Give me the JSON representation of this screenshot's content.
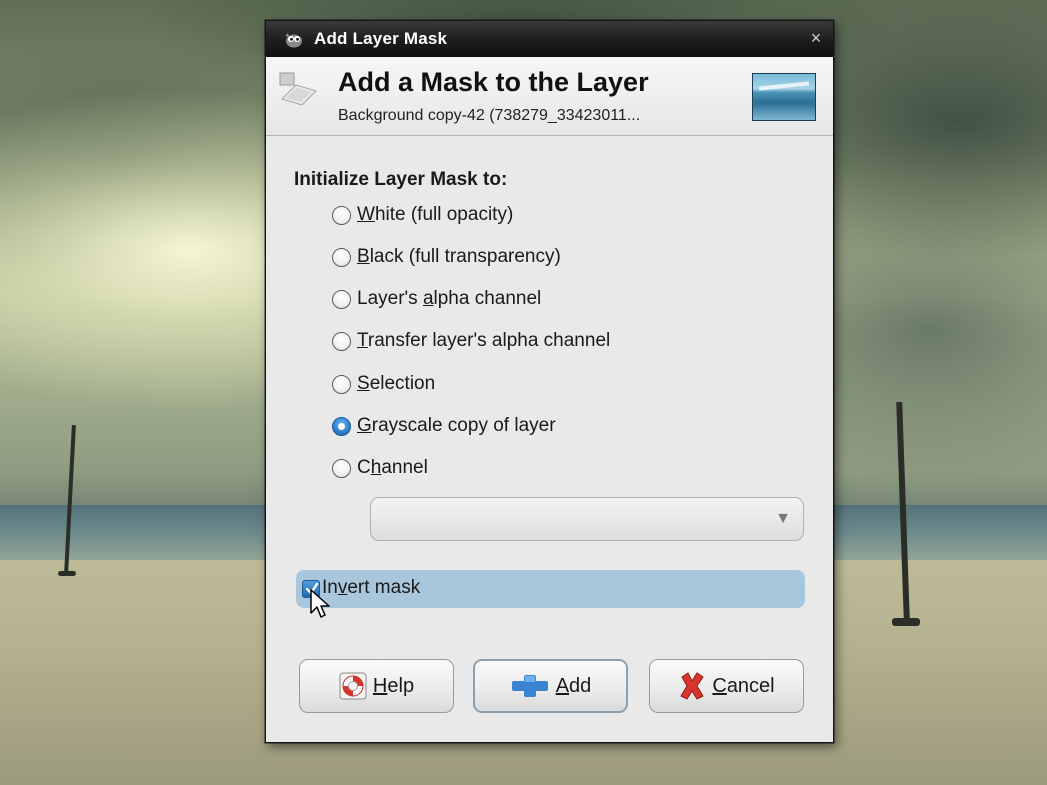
{
  "window": {
    "title": "Add Layer Mask",
    "app_icon": "gimp-wilber-icon",
    "close_glyph": "×"
  },
  "header": {
    "title": "Add a Mask to the Layer",
    "subtitle": "Background copy-42 (738279_33423011...",
    "icon": "layer-mask-icon",
    "thumbnail": "layer-thumbnail"
  },
  "init": {
    "label": "Initialize Layer Mask to:",
    "options": [
      {
        "pre": "",
        "u": "W",
        "post": "hite (full opacity)",
        "checked": false
      },
      {
        "pre": "",
        "u": "B",
        "post": "lack (full transparency)",
        "checked": false
      },
      {
        "pre": "Layer's ",
        "u": "a",
        "post": "lpha channel",
        "checked": false
      },
      {
        "pre": "",
        "u": "T",
        "post": "ransfer layer's alpha channel",
        "checked": false
      },
      {
        "pre": "",
        "u": "S",
        "post": "election",
        "checked": false
      },
      {
        "pre": "",
        "u": "G",
        "post": "rayscale copy of layer",
        "checked": true
      },
      {
        "pre": "C",
        "u": "h",
        "post": "annel",
        "checked": false
      }
    ],
    "selected": "Grayscale copy of layer"
  },
  "channel_select": {
    "value": "",
    "arrow": "▼"
  },
  "invert": {
    "pre": "In",
    "u": "v",
    "post": "ert mask",
    "checked": true
  },
  "buttons": {
    "help": {
      "pre": "",
      "u": "H",
      "post": "elp",
      "icon": "lifebuoy-icon"
    },
    "add": {
      "pre": "",
      "u": "A",
      "post": "dd",
      "icon": "plus-icon"
    },
    "cancel": {
      "pre": "",
      "u": "C",
      "post": "ancel",
      "icon": "cancel-x-icon"
    }
  },
  "colors": {
    "titlebar": "#1d1d1d",
    "dialog_bg": "#e9e9e9",
    "selected_radio": "#2f7fc9",
    "invert_highlight": "#a9c7dc",
    "add_icon": "#3a83d0",
    "cancel_icon": "#d9342b",
    "help_icon": "#d9342b"
  }
}
